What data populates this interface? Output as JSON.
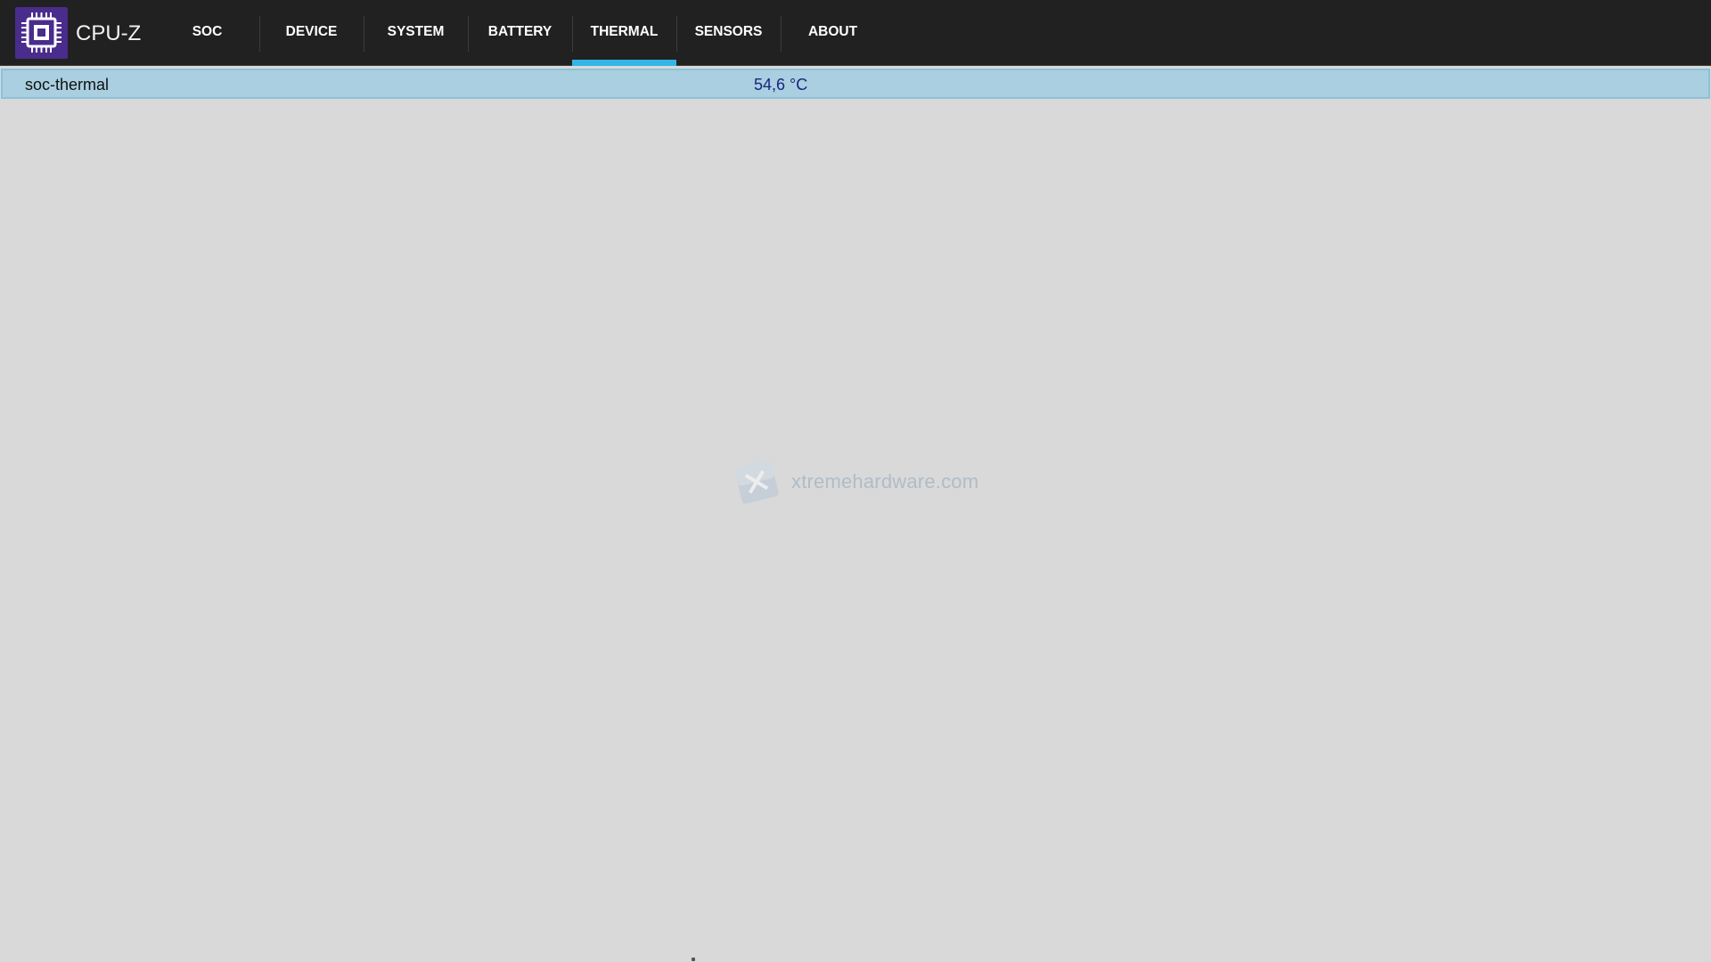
{
  "app": {
    "title": "CPU-Z",
    "logo_icon": "cpu-chip-icon",
    "brand_color": "#4a2c8c"
  },
  "tabs": [
    {
      "label": "SOC",
      "active": false
    },
    {
      "label": "DEVICE",
      "active": false
    },
    {
      "label": "SYSTEM",
      "active": false
    },
    {
      "label": "BATTERY",
      "active": false
    },
    {
      "label": "THERMAL",
      "active": true
    },
    {
      "label": "SENSORS",
      "active": false
    },
    {
      "label": "ABOUT",
      "active": false
    }
  ],
  "accent_color": "#33b5e5",
  "thermal": {
    "rows": [
      {
        "name": "soc-thermal",
        "value": "54,6 °C"
      }
    ]
  },
  "watermark": {
    "text": "xtremehardware.com",
    "icon": "x-logo-icon"
  }
}
